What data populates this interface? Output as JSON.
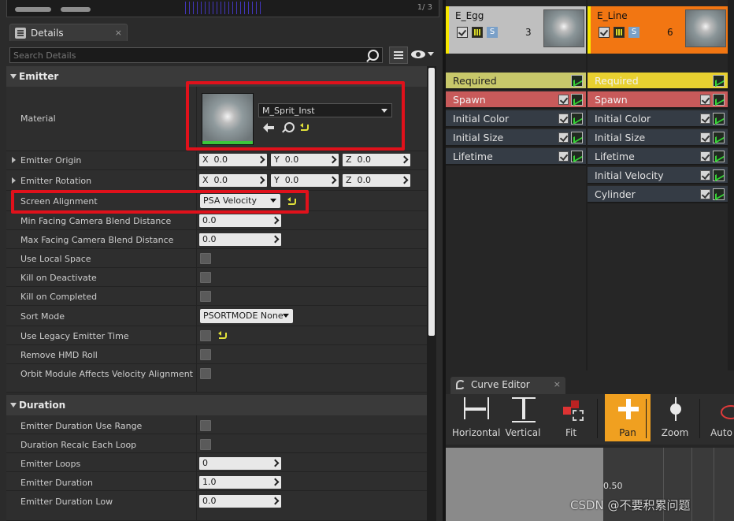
{
  "topstrip": {
    "counter": "1/ 3"
  },
  "details": {
    "tab_title": "Details",
    "tab_close": "×",
    "search_placeholder": "Search Details"
  },
  "emitter_section": {
    "title": "Emitter",
    "material": {
      "label": "Material",
      "value": "M_Sprit_Inst"
    },
    "emitter_origin": {
      "label": "Emitter Origin",
      "x": "0.0",
      "y": "0.0",
      "z": "0.0"
    },
    "emitter_rotation": {
      "label": "Emitter Rotation",
      "x": "0.0",
      "y": "0.0",
      "z": "0.0"
    },
    "axis_labels": {
      "x": "X",
      "y": "Y",
      "z": "Z"
    },
    "screen_alignment": {
      "label": "Screen Alignment",
      "value": "PSA Velocity"
    },
    "min_facing": {
      "label": "Min Facing Camera Blend Distance",
      "value": "0.0"
    },
    "max_facing": {
      "label": "Max Facing Camera Blend Distance",
      "value": "0.0"
    },
    "use_local_space": {
      "label": "Use Local Space",
      "checked": false
    },
    "kill_on_deactivate": {
      "label": "Kill on Deactivate",
      "checked": false
    },
    "kill_on_completed": {
      "label": "Kill on Completed",
      "checked": false
    },
    "sort_mode": {
      "label": "Sort Mode",
      "value": "PSORTMODE None"
    },
    "use_legacy": {
      "label": "Use Legacy Emitter Time",
      "checked": false
    },
    "remove_hmd": {
      "label": "Remove HMD Roll",
      "checked": false
    },
    "orbit_module": {
      "label": "Orbit Module Affects Velocity Alignment",
      "checked": false
    }
  },
  "duration_section": {
    "title": "Duration",
    "use_range": {
      "label": "Emitter Duration Use Range",
      "checked": false
    },
    "recalc": {
      "label": "Duration Recalc Each Loop",
      "checked": false
    },
    "loops": {
      "label": "Emitter Loops",
      "value": "0"
    },
    "duration": {
      "label": "Emitter Duration",
      "value": "1.0"
    },
    "duration_low": {
      "label": "Emitter Duration Low",
      "value": "0.0"
    }
  },
  "emitters": [
    {
      "name": "E_Egg",
      "count": "3",
      "header_color": "#bfbfbf",
      "badge_s": "S",
      "modules": [
        {
          "label": "Required",
          "bg": "#c8c86a",
          "fg": "#222"
        },
        {
          "label": "Spawn",
          "bg": "#c85a5a",
          "fg": "#f2f2f2"
        },
        {
          "label": "Initial Color",
          "bg": "#353c45",
          "fg": "#e2e2e2"
        },
        {
          "label": "Initial Size",
          "bg": "#353c45",
          "fg": "#e2e2e2"
        },
        {
          "label": "Lifetime",
          "bg": "#353c45",
          "fg": "#e2e2e2"
        }
      ]
    },
    {
      "name": "E_Line",
      "count": "6",
      "header_color": "#f27612",
      "badge_s": "S",
      "modules": [
        {
          "label": "Required",
          "bg": "#e8d030",
          "fg": "#f2f2f2"
        },
        {
          "label": "Spawn",
          "bg": "#c85a5a",
          "fg": "#f2f2f2"
        },
        {
          "label": "Initial Color",
          "bg": "#353c45",
          "fg": "#e2e2e2"
        },
        {
          "label": "Initial Size",
          "bg": "#353c45",
          "fg": "#e2e2e2"
        },
        {
          "label": "Lifetime",
          "bg": "#353c45",
          "fg": "#e2e2e2"
        },
        {
          "label": "Initial Velocity",
          "bg": "#353c45",
          "fg": "#e2e2e2"
        },
        {
          "label": "Cylinder",
          "bg": "#353c45",
          "fg": "#e2e2e2"
        }
      ]
    }
  ],
  "curve_editor": {
    "tab_title": "Curve Editor",
    "tab_close": "×",
    "buttons": [
      {
        "label": "Horizontal",
        "icon": "fit-horizontal-icon",
        "active": false
      },
      {
        "label": "Vertical",
        "icon": "fit-vertical-icon",
        "active": false
      },
      {
        "label": "Fit",
        "icon": "fit-icon",
        "active": false
      },
      {
        "label": "Pan",
        "icon": "pan-icon",
        "active": true
      },
      {
        "label": "Zoom",
        "icon": "zoom-icon",
        "active": false
      },
      {
        "label": "Auto",
        "icon": "auto-icon",
        "active": false
      }
    ],
    "graph_value": "0.50"
  },
  "watermark": "CSDN @不要积累问题",
  "colors": {
    "highlight_red": "#e0111b",
    "pan_active": "#f0a020",
    "emitter_selected_border": "#f7e700"
  }
}
